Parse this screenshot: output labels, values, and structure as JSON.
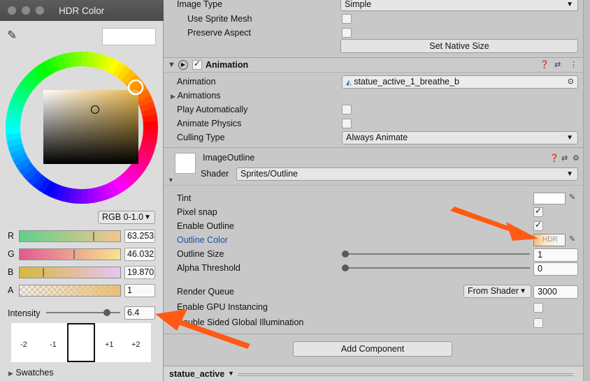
{
  "picker": {
    "title": "HDR Color",
    "mode": "RGB 0-1.0",
    "channels": [
      {
        "label": "R",
        "value": "63.253",
        "fraction": 0.74
      },
      {
        "label": "G",
        "value": "46.032",
        "fraction": 0.54
      },
      {
        "label": "B",
        "value": "19.870",
        "fraction": 0.23
      },
      {
        "label": "A",
        "value": "1",
        "fraction": 1.0
      }
    ],
    "intensity_label": "Intensity",
    "intensity_value": "6.4",
    "intensity_fraction": 0.82,
    "exposure_stops": [
      "-2",
      "-1",
      "+1",
      "+2"
    ],
    "swatches_label": "Swatches",
    "colors": {
      "current": "#ffffff",
      "hue_selected": "#ffd200"
    }
  },
  "image": {
    "image_type_label": "Image Type",
    "image_type_value": "Simple",
    "use_sprite_mesh": "Use Sprite Mesh",
    "preserve_aspect": "Preserve Aspect",
    "set_native_size": "Set Native Size"
  },
  "animation": {
    "title": "Animation",
    "animation_label": "Animation",
    "animation_value": "statue_active_1_breathe_b",
    "animations_label": "Animations",
    "play_auto": "Play Automatically",
    "animate_physics": "Animate Physics",
    "culling_label": "Culling Type",
    "culling_value": "Always Animate"
  },
  "material": {
    "title": "ImageOutline",
    "shader_label": "Shader",
    "shader_value": "Sprites/Outline",
    "props": {
      "tint": "Tint",
      "pixel_snap": "Pixel snap",
      "enable_outline": "Enable Outline",
      "outline_color": "Outline Color",
      "outline_size": "Outline Size",
      "outline_size_value": "1",
      "alpha_threshold": "Alpha Threshold",
      "alpha_threshold_value": "0",
      "render_queue": "Render Queue",
      "render_queue_mode": "From Shader",
      "render_queue_value": "3000",
      "gpu_instancing": "Enable GPU Instancing",
      "double_sided": "Double Sided Global Illumination"
    },
    "hdr_badge": "HDR",
    "colors": {
      "outline_gradient_start": "#f0c070",
      "accent_blue": "#1b4fa8"
    }
  },
  "add_component": "Add Component",
  "bottom_bar": {
    "tab": "statue_active"
  },
  "annotation_color": "#ff5a14"
}
